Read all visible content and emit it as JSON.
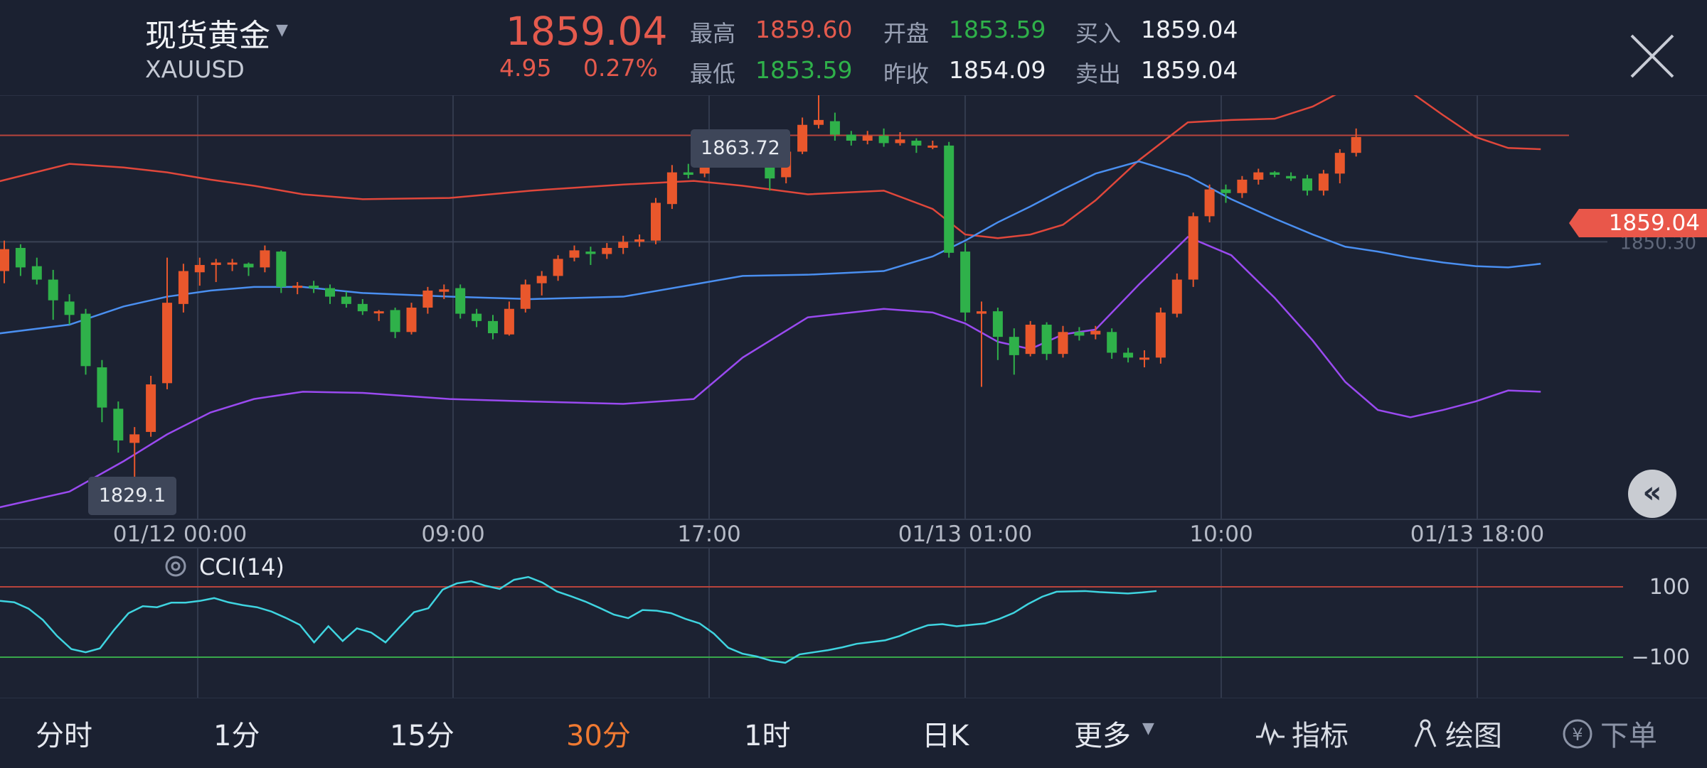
{
  "header": {
    "name": "现货黄金",
    "symbol": "XAUUSD",
    "price": "1859.04",
    "change": "4.95",
    "change_pct": "0.27%",
    "stats": [
      {
        "label": "最高",
        "value": "1859.60",
        "color": "red"
      },
      {
        "label": "最低",
        "value": "1853.59",
        "color": "green"
      },
      {
        "label": "开盘",
        "value": "1853.59",
        "color": "green"
      },
      {
        "label": "昨收",
        "value": "1854.09",
        "color": "white"
      },
      {
        "label": "买入",
        "value": "1859.04",
        "color": "white"
      },
      {
        "label": "卖出",
        "value": "1859.04",
        "color": "white"
      }
    ]
  },
  "colors": {
    "up": "#e9572c",
    "down": "#2fb14a",
    "upper_band": "#e0473b",
    "middle_band": "#4a8ff0",
    "lower_band": "#9a4af0",
    "cci_line": "#3fd4e0"
  },
  "main_chart": {
    "current_price_tag": "1859.04",
    "grid_price_label": "1850.30",
    "high_label": "1863.72",
    "low_label": "1829.1",
    "time_labels": [
      "01/12 00:00",
      "09:00",
      "17:00",
      "01/13 01:00",
      "10:00",
      "01/13 18:00"
    ]
  },
  "cci_panel": {
    "title": "CCI(14)",
    "levels": [
      "100",
      "−100"
    ]
  },
  "bottom_bar": {
    "timeframes": [
      "分时",
      "1分",
      "15分",
      "30分",
      "1时",
      "日K",
      "更多"
    ],
    "active": "30分",
    "tools": [
      "指标",
      "绘图",
      "下单"
    ]
  },
  "chart_data": {
    "type": "candlestick",
    "series": [
      {
        "name": "Price",
        "values": [
          [
            1847.9,
            1849.7,
            1846.9,
            1850.4
          ],
          [
            1849.8,
            1848.2,
            1847.5,
            1850.1
          ],
          [
            1848.3,
            1847.2,
            1846.8,
            1849.0
          ],
          [
            1847.2,
            1845.5,
            1843.9,
            1848.0
          ],
          [
            1845.4,
            1844.3,
            1843.5,
            1846.0
          ],
          [
            1844.4,
            1840.1,
            1839.4,
            1844.8
          ],
          [
            1840.0,
            1836.7,
            1835.5,
            1840.6
          ],
          [
            1836.6,
            1834.0,
            1833.0,
            1837.2
          ],
          [
            1833.8,
            1834.5,
            1829.1,
            1835.1
          ],
          [
            1834.7,
            1838.6,
            1834.3,
            1839.3
          ],
          [
            1838.7,
            1845.3,
            1838.2,
            1849.0
          ],
          [
            1845.2,
            1847.9,
            1844.5,
            1848.5
          ],
          [
            1847.8,
            1848.4,
            1846.7,
            1849.0
          ],
          [
            1848.4,
            1848.6,
            1847.0,
            1848.9
          ],
          [
            1848.5,
            1848.6,
            1847.9,
            1848.9
          ],
          [
            1848.5,
            1848.2,
            1847.5,
            1848.6
          ],
          [
            1848.2,
            1849.6,
            1847.8,
            1850.0
          ],
          [
            1849.5,
            1846.6,
            1846.1,
            1849.6
          ],
          [
            1846.7,
            1846.7,
            1846.0,
            1847.0
          ],
          [
            1846.7,
            1846.5,
            1846.1,
            1847.1
          ],
          [
            1846.5,
            1845.8,
            1845.2,
            1846.8
          ],
          [
            1845.8,
            1845.2,
            1844.9,
            1846.2
          ],
          [
            1845.2,
            1844.6,
            1844.3,
            1845.6
          ],
          [
            1844.6,
            1844.6,
            1843.8,
            1844.7
          ],
          [
            1844.7,
            1842.9,
            1842.4,
            1844.9
          ],
          [
            1842.9,
            1844.9,
            1842.7,
            1845.3
          ],
          [
            1844.9,
            1846.3,
            1844.4,
            1846.6
          ],
          [
            1846.2,
            1846.4,
            1845.6,
            1846.8
          ],
          [
            1846.5,
            1844.4,
            1844.0,
            1846.8
          ],
          [
            1844.4,
            1843.8,
            1843.3,
            1844.8
          ],
          [
            1843.8,
            1842.8,
            1842.3,
            1844.3
          ],
          [
            1842.7,
            1844.8,
            1842.6,
            1845.4
          ],
          [
            1844.8,
            1846.8,
            1844.5,
            1847.2
          ],
          [
            1846.9,
            1847.5,
            1845.9,
            1847.9
          ],
          [
            1847.5,
            1848.9,
            1847.1,
            1849.2
          ],
          [
            1849.0,
            1849.6,
            1848.7,
            1850.0
          ],
          [
            1849.5,
            1849.3,
            1848.4,
            1849.9
          ],
          [
            1849.3,
            1849.8,
            1848.9,
            1850.2
          ],
          [
            1849.8,
            1850.3,
            1849.3,
            1850.8
          ],
          [
            1850.3,
            1850.5,
            1849.9,
            1850.9
          ],
          [
            1850.4,
            1853.5,
            1850.1,
            1853.9
          ],
          [
            1853.4,
            1856.0,
            1853.0,
            1856.6
          ],
          [
            1856.0,
            1855.8,
            1855.5,
            1856.7
          ],
          [
            1855.9,
            1857.9,
            1855.6,
            1858.4
          ],
          [
            1857.9,
            1858.2,
            1857.6,
            1858.7
          ],
          [
            1858.2,
            1858.4,
            1858.0,
            1859.0
          ],
          [
            1858.4,
            1857.3,
            1856.4,
            1858.6
          ],
          [
            1857.3,
            1855.5,
            1854.5,
            1857.4
          ],
          [
            1855.6,
            1857.7,
            1855.1,
            1858.0
          ],
          [
            1857.7,
            1859.9,
            1857.5,
            1860.5
          ],
          [
            1859.9,
            1860.3,
            1859.6,
            1863.72
          ],
          [
            1860.2,
            1859.1,
            1858.6,
            1860.9
          ],
          [
            1859.1,
            1858.6,
            1858.2,
            1859.4
          ],
          [
            1858.6,
            1859.0,
            1858.3,
            1859.4
          ],
          [
            1859.0,
            1858.4,
            1858.1,
            1859.6
          ],
          [
            1858.4,
            1858.7,
            1858.2,
            1859.3
          ],
          [
            1858.6,
            1858.2,
            1857.6,
            1858.8
          ],
          [
            1858.2,
            1858.2,
            1857.9,
            1858.6
          ],
          [
            1858.2,
            1849.4,
            1849.0,
            1858.5
          ],
          [
            1849.5,
            1844.5,
            1843.8,
            1850.2
          ],
          [
            1844.4,
            1844.6,
            1838.4,
            1845.4
          ],
          [
            1844.6,
            1842.5,
            1840.6,
            1844.9
          ],
          [
            1842.5,
            1841.0,
            1839.4,
            1843.2
          ],
          [
            1841.1,
            1843.5,
            1840.9,
            1843.8
          ],
          [
            1843.5,
            1841.1,
            1840.6,
            1843.7
          ],
          [
            1841.1,
            1842.9,
            1840.8,
            1843.4
          ],
          [
            1842.9,
            1842.6,
            1842.2,
            1843.3
          ],
          [
            1842.7,
            1843.0,
            1842.3,
            1843.4
          ],
          [
            1842.9,
            1841.2,
            1840.7,
            1843.2
          ],
          [
            1841.2,
            1840.8,
            1840.4,
            1841.6
          ],
          [
            1840.7,
            1840.8,
            1840.0,
            1841.4
          ],
          [
            1840.8,
            1844.5,
            1840.3,
            1844.9
          ],
          [
            1844.4,
            1847.2,
            1844.1,
            1847.7
          ],
          [
            1847.2,
            1852.4,
            1846.6,
            1852.7
          ],
          [
            1852.4,
            1854.6,
            1851.9,
            1855.0
          ],
          [
            1854.6,
            1854.3,
            1853.5,
            1855.0
          ],
          [
            1854.3,
            1855.4,
            1853.9,
            1855.7
          ],
          [
            1855.4,
            1856.0,
            1855.0,
            1856.3
          ],
          [
            1856.0,
            1855.8,
            1855.6,
            1856.1
          ],
          [
            1855.7,
            1855.5,
            1855.3,
            1856.0
          ],
          [
            1855.5,
            1854.5,
            1854.1,
            1855.8
          ],
          [
            1854.5,
            1855.9,
            1854.1,
            1856.2
          ],
          [
            1855.9,
            1857.6,
            1855.1,
            1857.9
          ],
          [
            1857.6,
            1858.9,
            1857.3,
            1859.6
          ]
        ]
      }
    ],
    "bands": {
      "upper": [
        1854.7,
        1856.7,
        1856.4,
        1856.0,
        1855.4,
        1854.9,
        1854.2,
        1853.8,
        1853.9,
        1854.5,
        1855.0,
        1855.3,
        1854.9,
        1854.2,
        1854.5,
        1853.0,
        1850.9,
        1850.6,
        1850.9,
        1851.7,
        1853.7,
        1857.0,
        1860.1,
        1860.3,
        1860.4,
        1861.4,
        1862.8,
        1863.2,
        1862.6,
        1860.7,
        1858.9,
        1858.0,
        1857.9
      ],
      "middle": [
        1842.5,
        1843.5,
        1845.0,
        1845.8,
        1846.3,
        1846.6,
        1846.6,
        1846.1,
        1845.8,
        1845.6,
        1845.8,
        1846.8,
        1847.5,
        1847.6,
        1847.9,
        1849.1,
        1850.4,
        1851.9,
        1853.2,
        1854.6,
        1855.9,
        1856.9,
        1855.7,
        1853.8,
        1852.2,
        1850.9,
        1849.9,
        1849.5,
        1849.0,
        1848.6,
        1848.3,
        1848.2,
        1848.5
      ],
      "lower": [
        1828.0,
        1829.8,
        1832.3,
        1834.5,
        1836.3,
        1837.4,
        1838.0,
        1837.9,
        1837.4,
        1837.2,
        1837.0,
        1837.4,
        1840.8,
        1844.1,
        1844.8,
        1844.5,
        1843.6,
        1842.1,
        1841.5,
        1842.7,
        1843.1,
        1846.8,
        1850.7,
        1849.2,
        1845.7,
        1842.2,
        1838.8,
        1836.5,
        1835.9,
        1836.5,
        1837.2,
        1838.1,
        1838.0
      ],
      "x": [
        -6,
        12,
        22,
        30,
        38,
        46,
        55,
        66,
        82,
        97,
        114,
        127,
        136,
        148,
        162,
        171,
        177,
        183,
        189,
        195,
        201,
        209,
        218,
        226,
        234,
        241,
        247,
        253,
        259,
        265,
        271,
        277,
        283
      ]
    },
    "cci": [
      60,
      56,
      38,
      6,
      -40,
      -77,
      -86,
      -75,
      -22,
      25,
      45,
      42,
      55,
      55,
      60,
      68,
      56,
      48,
      42,
      30,
      12,
      -8,
      -58,
      -12,
      -54,
      -18,
      -30,
      -58,
      -14,
      28,
      39,
      92,
      110,
      116,
      103,
      94,
      120,
      128,
      112,
      87,
      73,
      58,
      40,
      21,
      11,
      34,
      32,
      25,
      9,
      -4,
      -33,
      -73,
      -90,
      -98,
      -110,
      -116,
      -92,
      -86,
      -80,
      -72,
      -62,
      -57,
      -52,
      -40,
      -23,
      -9,
      -6,
      -12,
      -8,
      -4,
      9,
      26,
      51,
      72,
      86,
      87,
      88,
      85,
      83,
      81,
      84,
      88
    ],
    "x_labels": [
      "01/12 00:00",
      "09:00",
      "17:00",
      "01/13 01:00",
      "10:00",
      "01/13 18:00"
    ],
    "y_range": [
      1826,
      1868
    ],
    "cci_levels": [
      100,
      -100
    ]
  }
}
